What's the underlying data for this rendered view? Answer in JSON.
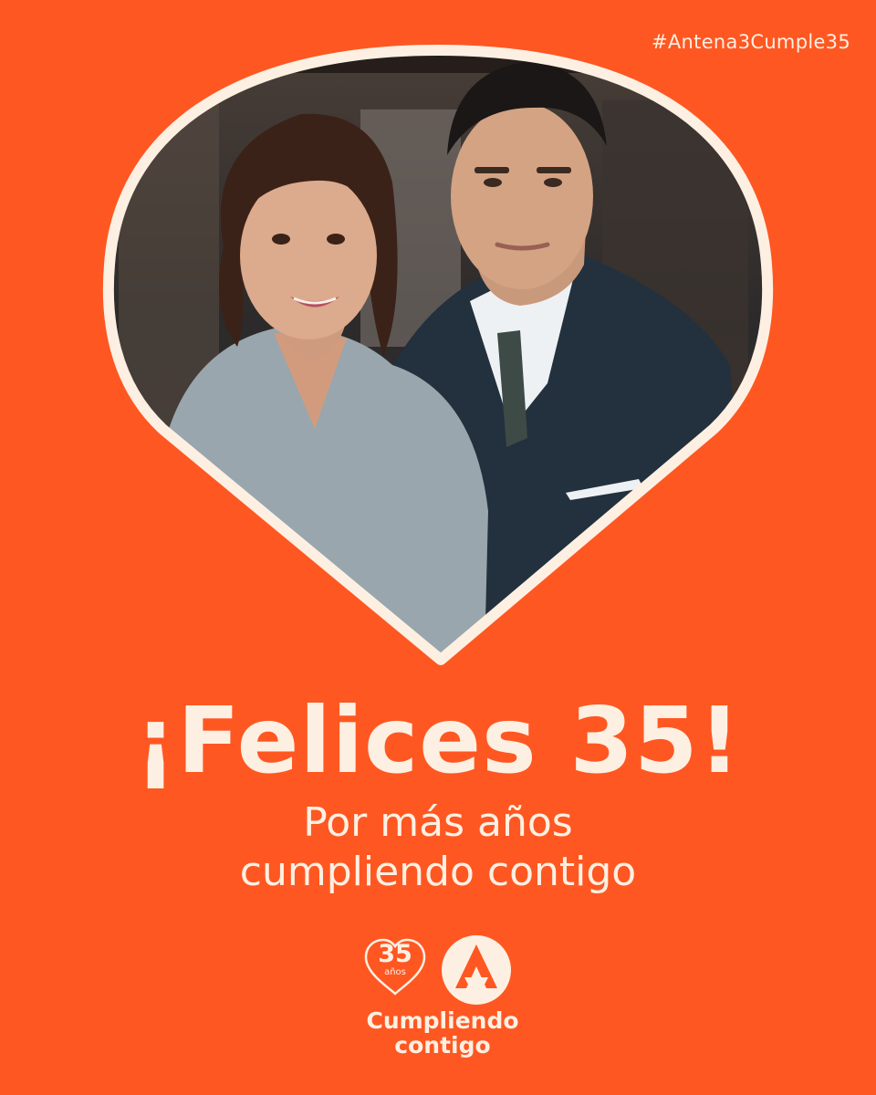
{
  "hashtag": "#Antena3Cumple35",
  "headline": "¡Felices 35!",
  "tagline": {
    "line1": "Por más años",
    "line2": "cumpliendo contigo"
  },
  "logo": {
    "number": "35",
    "years": "años",
    "line1": "Cumpliendo",
    "line2": "contigo"
  },
  "colors": {
    "background": "#ff5722",
    "cream": "#fdf0e2"
  },
  "icons": {
    "frame": "heart-photo-frame",
    "brand": "antena3-a-logo-icon"
  }
}
